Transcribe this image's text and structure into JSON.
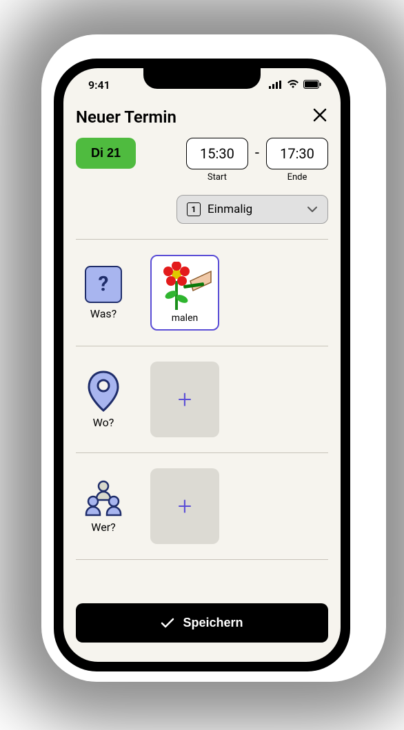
{
  "status": {
    "time": "9:41"
  },
  "header": {
    "title": "Neuer Termin"
  },
  "date": {
    "chip": "Di 21"
  },
  "start": {
    "value": "15:30",
    "label": "Start"
  },
  "end": {
    "value": "17:30",
    "label": "Ende"
  },
  "repeat": {
    "badge": "1",
    "label": "Einmalig"
  },
  "sections": {
    "what": {
      "label": "Was?",
      "item_label": "malen"
    },
    "where": {
      "label": "Wo?"
    },
    "who": {
      "label": "Wer?"
    }
  },
  "save": {
    "label": "Speichern"
  }
}
